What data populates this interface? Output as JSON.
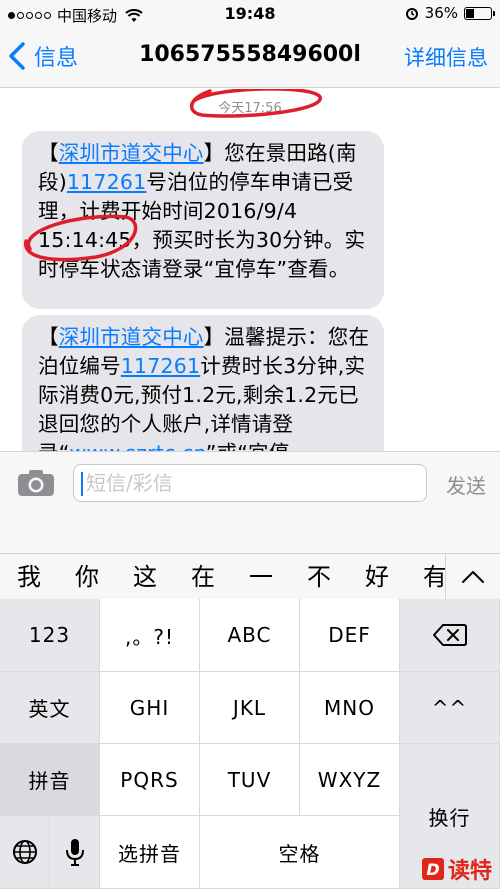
{
  "status_bar": {
    "carrier": "中国移动",
    "time": "19:48",
    "battery": "36%",
    "battery_level": 0.36
  },
  "nav": {
    "back_label": "信息",
    "title": "10657555849600l",
    "details_label": "详细信息"
  },
  "messages": {
    "timestamp": "今天17:56",
    "msg1": {
      "open": "【",
      "sender_link": "深圳市道交中心",
      "close_text": "】您在景田路(南段)",
      "bay_link": "117261",
      "body": "号泊位的停车申请已受理，计费开始时间2016/9/4 15:14:45，预买时长为30分钟。实时停车状态请登录“宜停车”查看。"
    },
    "msg2": {
      "open": "【",
      "sender_link": "深圳市道交中心",
      "mid_text": "】温馨提示：您在泊位编号",
      "bay_link": "117261",
      "body": "计费时长3分钟,实际消费0元,预付1.2元,剩余1.2元已退回您的个人账户,详情请登录“",
      "url_link": "www.szrtc.cn",
      "tail": "”或“宜停"
    }
  },
  "compose": {
    "placeholder": "短信/彩信",
    "send_label": "发送"
  },
  "candidates": [
    "我",
    "你",
    "这",
    "在",
    "一",
    "不",
    "好",
    "有"
  ],
  "keyboard": {
    "row1": [
      "123",
      ",。?!",
      "ABC",
      "DEF"
    ],
    "row2": [
      "英文",
      "GHI",
      "JKL",
      "MNO",
      "^^"
    ],
    "row3": [
      "拼音",
      "PQRS",
      "TUV",
      "WXYZ"
    ],
    "row4": [
      "选拼音",
      "空格"
    ],
    "return_label": "换行"
  },
  "watermark": {
    "logo": "D",
    "text": "读特"
  }
}
